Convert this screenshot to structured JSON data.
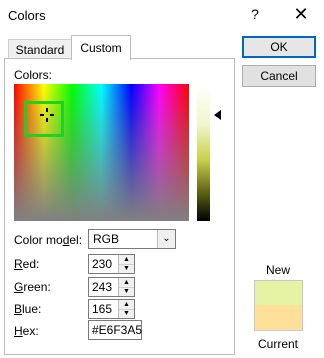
{
  "window": {
    "title": "Colors",
    "help_label": "?",
    "close_label": "✕"
  },
  "tabs": [
    {
      "label": "Standard",
      "selected": false
    },
    {
      "label": "Custom",
      "selected": true
    }
  ],
  "custom": {
    "colors_label": "Colors:",
    "luminance_arrow": "◀",
    "color_model": {
      "label": "Color model:",
      "label_underline_char": "d",
      "value": "RGB",
      "options_visible": [
        "RGB"
      ]
    },
    "red": {
      "label": "Red:",
      "underline_char": "R",
      "value": "230"
    },
    "green": {
      "label": "Green:",
      "underline_char": "G",
      "value": "243"
    },
    "blue": {
      "label": "Blue:",
      "underline_char": "B",
      "value": "165"
    },
    "hex": {
      "label": "Hex:",
      "underline_char": "H",
      "value": "#E6F3A5"
    }
  },
  "buttons": {
    "ok": "OK",
    "cancel": "Cancel"
  },
  "preview": {
    "new_label": "New",
    "current_label": "Current",
    "new_color": "#e6f3a5",
    "current_color": "#ffe09a"
  },
  "colors": {
    "selector_green": "#22d022",
    "ok_border": "#0067c0"
  }
}
